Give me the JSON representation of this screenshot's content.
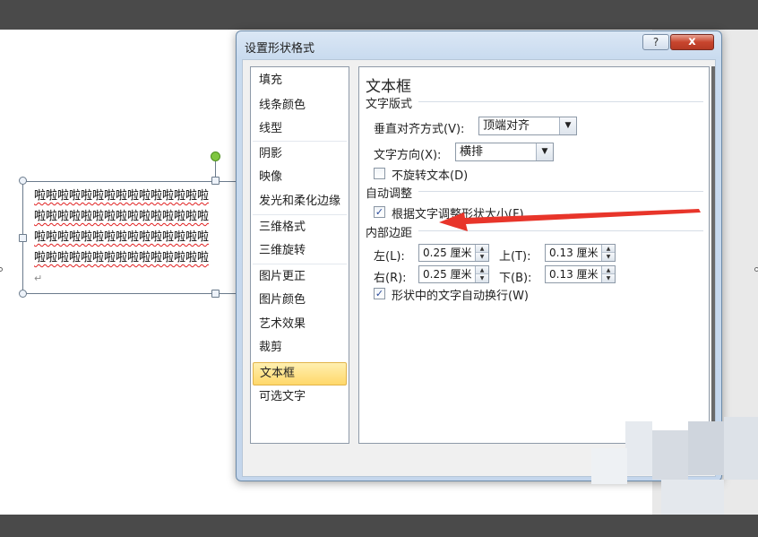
{
  "dialog": {
    "title": "设置形状格式",
    "help_label": "?",
    "close_label": "x"
  },
  "categories": [
    {
      "label": "填充"
    },
    {
      "label": "线条颜色"
    },
    {
      "label": "线型"
    },
    {
      "label": "阴影"
    },
    {
      "label": "映像"
    },
    {
      "label": "发光和柔化边缘"
    },
    {
      "label": "三维格式"
    },
    {
      "label": "三维旋转"
    },
    {
      "label": "图片更正"
    },
    {
      "label": "图片颜色"
    },
    {
      "label": "艺术效果"
    },
    {
      "label": "裁剪"
    },
    {
      "label": "文本框",
      "selected": true
    },
    {
      "label": "可选文字"
    }
  ],
  "panel": {
    "title": "文本框",
    "text_layout": {
      "section_label": "文字版式",
      "valign_label": "垂直对齐方式(V):",
      "valign_value": "顶端对齐",
      "direction_label": "文字方向(X):",
      "direction_value": "横排",
      "no_rotate_label": "不旋转文本(D)",
      "no_rotate_checked": false
    },
    "autofit": {
      "section_label": "自动调整",
      "resize_label": "根据文字调整形状大小(F)",
      "resize_checked": true
    },
    "margins": {
      "section_label": "内部边距",
      "left_label": "左(L):",
      "left_value": "0.25 厘米",
      "top_label": "上(T):",
      "top_value": "0.13 厘米",
      "right_label": "右(R):",
      "right_value": "0.25 厘米",
      "bottom_label": "下(B):",
      "bottom_value": "0.13 厘米",
      "wrap_label": "形状中的文字自动换行(W)",
      "wrap_checked": true
    }
  },
  "slide_textbox": {
    "lines": [
      "啦啦啦啦啦啦啦啦啦啦啦啦啦啦啦",
      "啦啦啦啦啦啦啦啦啦啦啦啦啦啦啦",
      "啦啦啦啦啦啦啦啦啦啦啦啦啦啦啦",
      "啦啦啦啦啦啦啦啦啦啦啦啦啦啦啦"
    ],
    "paragraph_mark": "↵"
  },
  "colors": {
    "arrow": "#e8352a",
    "selection_highlight": "#ffd86a",
    "rotation_handle": "#7fc640"
  }
}
